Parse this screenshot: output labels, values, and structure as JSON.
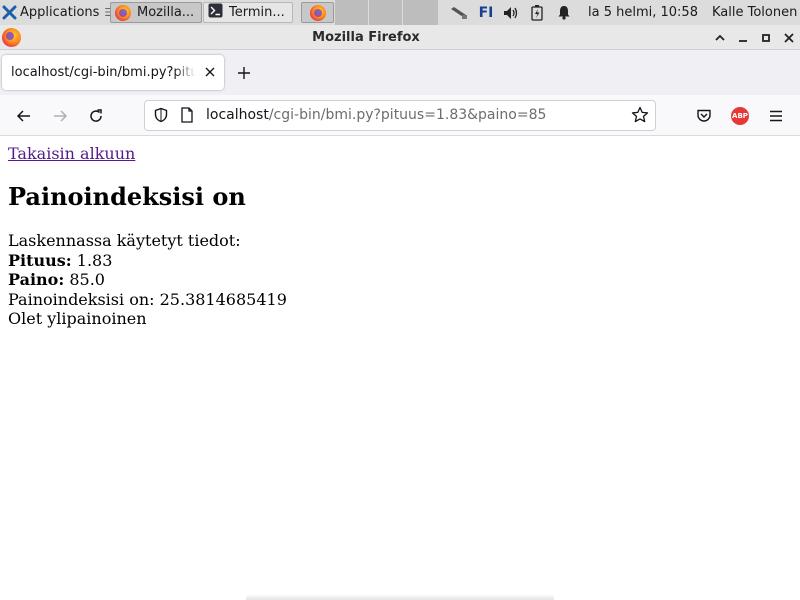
{
  "panel": {
    "applications_label": "Applications",
    "tasks": [
      {
        "label": "Mozilla..."
      },
      {
        "label": "Termin..."
      }
    ],
    "keyboard_layout": "FI",
    "clock": "la  5 helmi, 10:58",
    "user": "Kalle Tolonen"
  },
  "window": {
    "title": "Mozilla Firefox"
  },
  "tab": {
    "label": "localhost/cgi-bin/bmi.py?pituus=1.83&paino=85"
  },
  "urlbar": {
    "host": "localhost",
    "path": "/cgi-bin/bmi.py?pituus=1.83&paino=85"
  },
  "addon": {
    "label": "ABP"
  },
  "page": {
    "back_link": "Takaisin alkuun",
    "heading": "Painoindeksisi on",
    "intro": "Laskennassa käytetyt tiedot:",
    "height_label": "Pituus:",
    "height_value": "1.83",
    "weight_label": "Paino:",
    "weight_value": "85.0",
    "bmi_line": "Painoindeksisi on: 25.3814685419",
    "verdict": "Olet ylipainoinen"
  }
}
